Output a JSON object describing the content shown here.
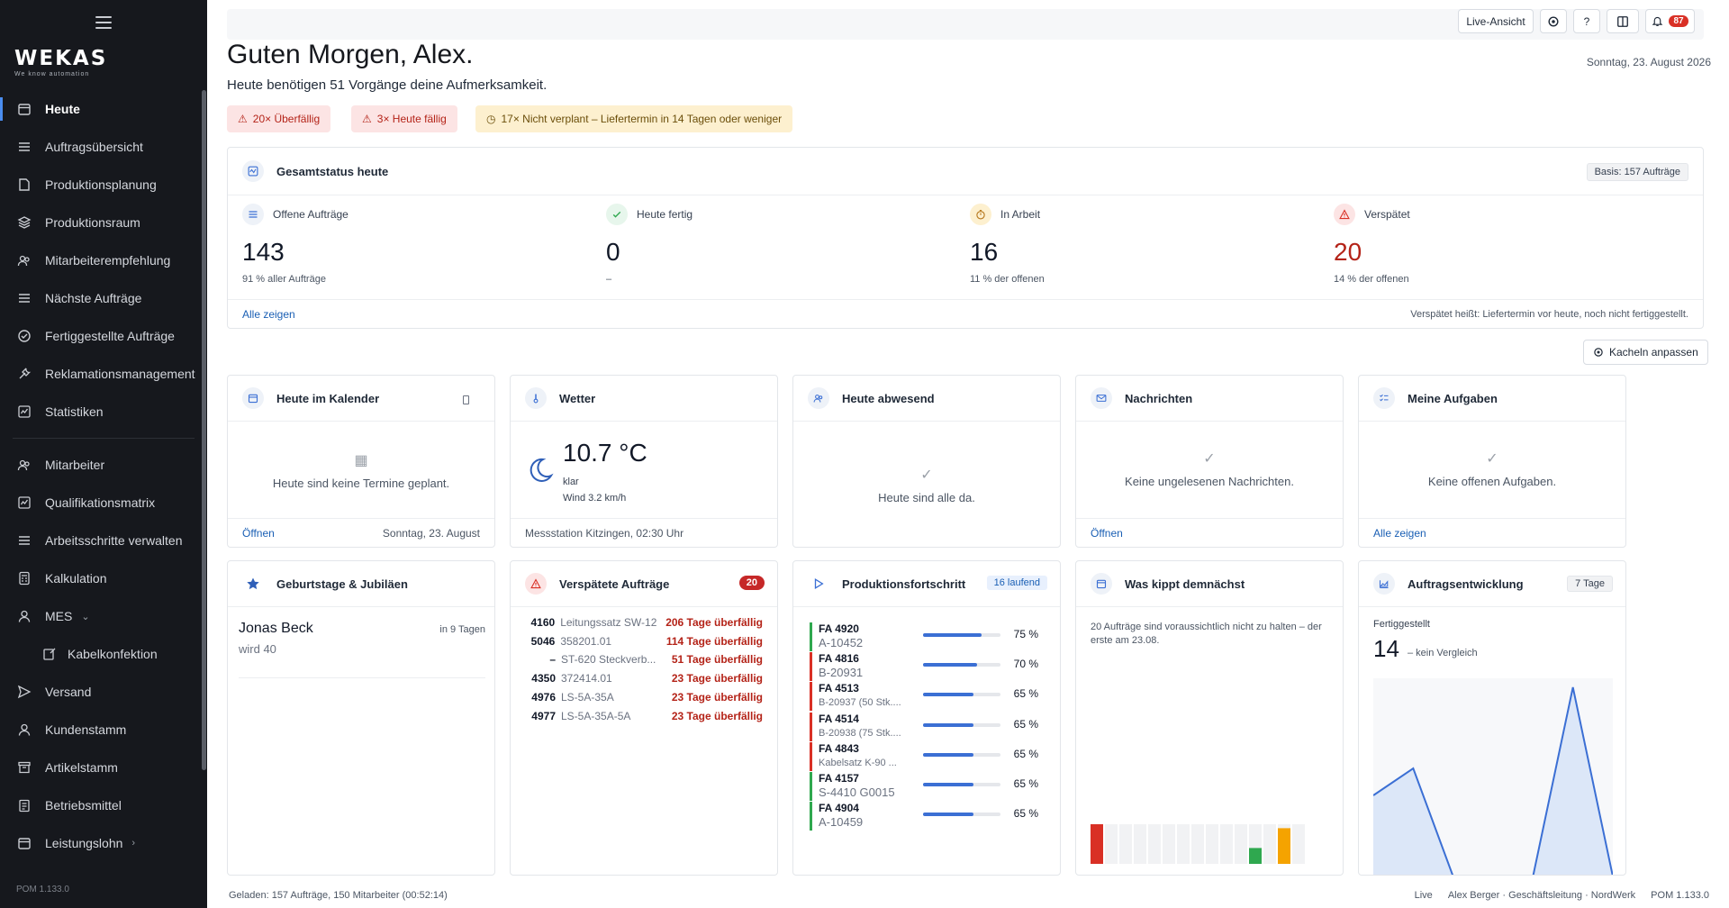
{
  "sidebar": {
    "brand": "WEKAS",
    "tagline": "We know automation",
    "items": [
      {
        "label": "Heute",
        "icon": "calendar-icon"
      },
      {
        "label": "Auftragsübersicht",
        "icon": "list-icon"
      },
      {
        "label": "Produktionsplanung",
        "icon": "planning-icon"
      },
      {
        "label": "Produktionsraum",
        "icon": "layers-icon"
      },
      {
        "label": "Mitarbeiterempfehlung",
        "icon": "users-icon"
      },
      {
        "label": "Nächste Aufträge",
        "icon": "list-icon"
      },
      {
        "label": "Fertiggestellte Aufträge",
        "icon": "check-circle-icon"
      },
      {
        "label": "Reklamationsmanagement",
        "icon": "wrench-icon"
      },
      {
        "label": "Statistiken",
        "icon": "chart-icon"
      },
      {
        "label": "Mitarbeiter",
        "icon": "users-icon"
      },
      {
        "label": "Qualifikationsmatrix",
        "icon": "chart-icon"
      },
      {
        "label": "Arbeitsschritte verwalten",
        "icon": "list-icon"
      },
      {
        "label": "Kalkulation",
        "icon": "calculator-icon"
      },
      {
        "label": "MES",
        "icon": "user-icon"
      },
      {
        "label": "Kabelkonfektion",
        "icon": "edit-icon"
      },
      {
        "label": "Versand",
        "icon": "send-icon"
      },
      {
        "label": "Kundenstamm",
        "icon": "user-icon"
      },
      {
        "label": "Artikelstamm",
        "icon": "archive-icon"
      },
      {
        "label": "Betriebsmittel",
        "icon": "clipboard-icon"
      },
      {
        "label": "Leistungslohn",
        "icon": "calendar-icon"
      }
    ],
    "version": "POM 1.133.0"
  },
  "topbar": {
    "live_label": "Live-Ansicht",
    "help_label": "?",
    "notif_count": "87"
  },
  "header": {
    "greeting": "Guten Morgen, Alex.",
    "subline": "Heute benötigen 51 Vorgänge deine Aufmerksamkeit.",
    "date": "Sonntag, 23. August 2026"
  },
  "chips": {
    "overdue": "20× Überfällig",
    "due_today": "3× Heute fällig",
    "unplanned": "17× Nicht verplant – Liefertermin in 14 Tagen oder weniger"
  },
  "status": {
    "title": "Gesamtstatus heute",
    "basis": "Basis: 157 Aufträge",
    "kpis": [
      {
        "label": "Offene Aufträge",
        "value": "143",
        "sub": "91 % aller Aufträge"
      },
      {
        "label": "Heute fertig",
        "value": "0",
        "sub": "–"
      },
      {
        "label": "In Arbeit",
        "value": "16",
        "sub": "11 % der offenen"
      },
      {
        "label": "Verspätet",
        "value": "20",
        "sub": "14 % der offenen"
      }
    ],
    "show_all": "Alle zeigen",
    "note": "Verspätet heißt: Liefertermin vor heute, noch nicht fertiggestellt."
  },
  "tiles_button": "Kacheln anpassen",
  "calendar_tile": {
    "title": "Heute im Kalender",
    "empty": "Heute sind keine Termine geplant.",
    "open": "Öffnen",
    "date": "Sonntag, 23. August"
  },
  "weather_tile": {
    "title": "Wetter",
    "temp": "10.7 °C",
    "condition": "klar",
    "wind": "Wind 3.2 km/h",
    "station": "Messstation Kitzingen, 02:30 Uhr"
  },
  "absent_tile": {
    "title": "Heute abwesend",
    "empty": "Heute sind alle da."
  },
  "messages_tile": {
    "title": "Nachrichten",
    "empty": "Keine ungelesenen Nachrichten.",
    "open": "Öffnen"
  },
  "tasks_tile": {
    "title": "Meine Aufgaben",
    "empty": "Keine offenen Aufgaben.",
    "show_all": "Alle zeigen"
  },
  "birthday_tile": {
    "title": "Geburtstage & Jubiläen",
    "name": "Jonas Beck",
    "detail": "wird 40",
    "when": "in 9 Tagen"
  },
  "overdue_tile": {
    "title": "Verspätete Aufträge",
    "count": "20",
    "rows": [
      {
        "id": "4160",
        "desc": "Leitungssatz SW-12",
        "late": "206 Tage überfällig"
      },
      {
        "id": "5046",
        "desc": "358201.01",
        "late": "114 Tage überfällig"
      },
      {
        "id": "–",
        "desc": "ST-620 Steckverb...",
        "late": "51 Tage überfällig"
      },
      {
        "id": "4350",
        "desc": "372414.01",
        "late": "23 Tage überfällig"
      },
      {
        "id": "4976",
        "desc": "LS-5A-35A",
        "late": "23 Tage überfällig"
      },
      {
        "id": "4977",
        "desc": "LS-5A-35A-5A",
        "late": "23 Tage überfällig"
      }
    ]
  },
  "progress_tile": {
    "title": "Produktionsfortschritt",
    "count": "16 laufend",
    "rows": [
      {
        "fa": "FA 4920",
        "sub": "A-10452",
        "pct": "75 %",
        "value": 75,
        "status": "#2fa84f"
      },
      {
        "fa": "FA 4816",
        "sub": "B-20931",
        "pct": "70 %",
        "value": 70,
        "status": "#d93025"
      },
      {
        "fa": "FA 4513",
        "sub": "B-20937 (50 Stk....",
        "pct": "65 %",
        "value": 65,
        "status": "#d93025"
      },
      {
        "fa": "FA 4514",
        "sub": "B-20938 (75 Stk....",
        "pct": "65 %",
        "value": 65,
        "status": "#d93025"
      },
      {
        "fa": "FA 4843",
        "sub": "Kabelsatz K-90 ...",
        "pct": "65 %",
        "value": 65,
        "status": "#d93025"
      },
      {
        "fa": "FA 4157",
        "sub": "S-4410 G0015",
        "pct": "65 %",
        "value": 65,
        "status": "#2fa84f"
      },
      {
        "fa": "FA 4904",
        "sub": "A-10459",
        "pct": "65 %",
        "value": 65,
        "status": "#2fa84f"
      }
    ]
  },
  "risk_tile": {
    "title": "Was kippt demnächst",
    "text": "20 Aufträge sind voraussichtlich nicht zu halten – der erste am 23.08.",
    "bars": [
      1,
      0,
      0,
      0,
      0,
      0,
      0,
      0,
      0,
      0,
      0,
      0.4,
      0,
      0.9,
      0
    ]
  },
  "trend_tile": {
    "title": "Auftragsentwicklung",
    "range": "7 Tage",
    "label": "Fertiggestellt",
    "value": "14",
    "compare": "– kein Vergleich",
    "points": [
      3,
      4,
      0,
      0,
      0,
      7,
      0
    ]
  },
  "footer": {
    "loaded": "Geladen: 157 Aufträge, 150 Mitarbeiter (00:52:14)",
    "mode": "Live",
    "user": "Alex Berger · Geschäftsleitung · NordWerk",
    "version": "POM 1.133.0"
  }
}
